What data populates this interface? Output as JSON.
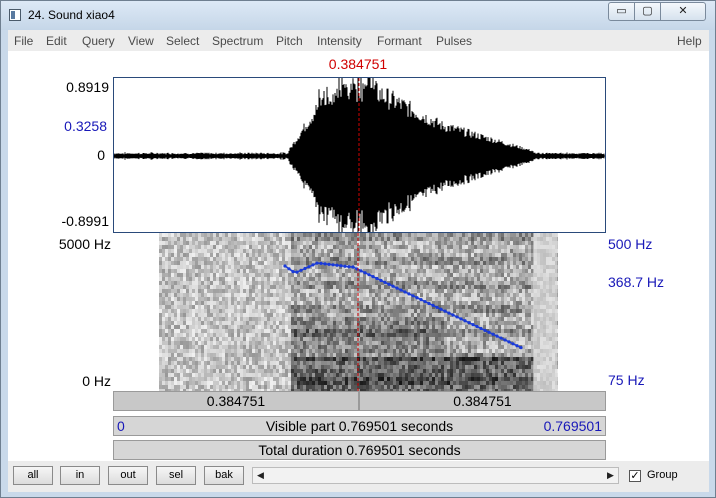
{
  "window": {
    "title": "24. Sound xiao4",
    "minimize_label": "▭",
    "maximize_label": "▢",
    "close_label": "✕"
  },
  "menu": [
    "File",
    "Edit",
    "Query",
    "View",
    "Select",
    "Spectrum",
    "Pitch",
    "Intensity",
    "Formant",
    "Pulses",
    "Help"
  ],
  "waveform": {
    "cursor_time": "0.384751",
    "y_max": "0.8919",
    "y_cursor_value": "0.3258",
    "y_zero": "0",
    "y_min": "-0.8991"
  },
  "spectrogram": {
    "freq_top": "5000 Hz",
    "freq_bottom": "0 Hz",
    "pitch_top": "500 Hz",
    "pitch_cursor": "368.7 Hz",
    "pitch_bottom": "75 Hz",
    "pitch_color": "#1a3ad8",
    "cursor_color": "#d00000"
  },
  "selection": {
    "left_part": "0.384751",
    "right_part": "0.384751"
  },
  "visible": {
    "start": "0",
    "label": "Visible part 0.769501 seconds",
    "end": "0.769501"
  },
  "total": {
    "label": "Total duration 0.769501 seconds"
  },
  "buttons": [
    "all",
    "in",
    "out",
    "sel",
    "bak"
  ],
  "group": {
    "label": "Group",
    "checked": true
  }
}
